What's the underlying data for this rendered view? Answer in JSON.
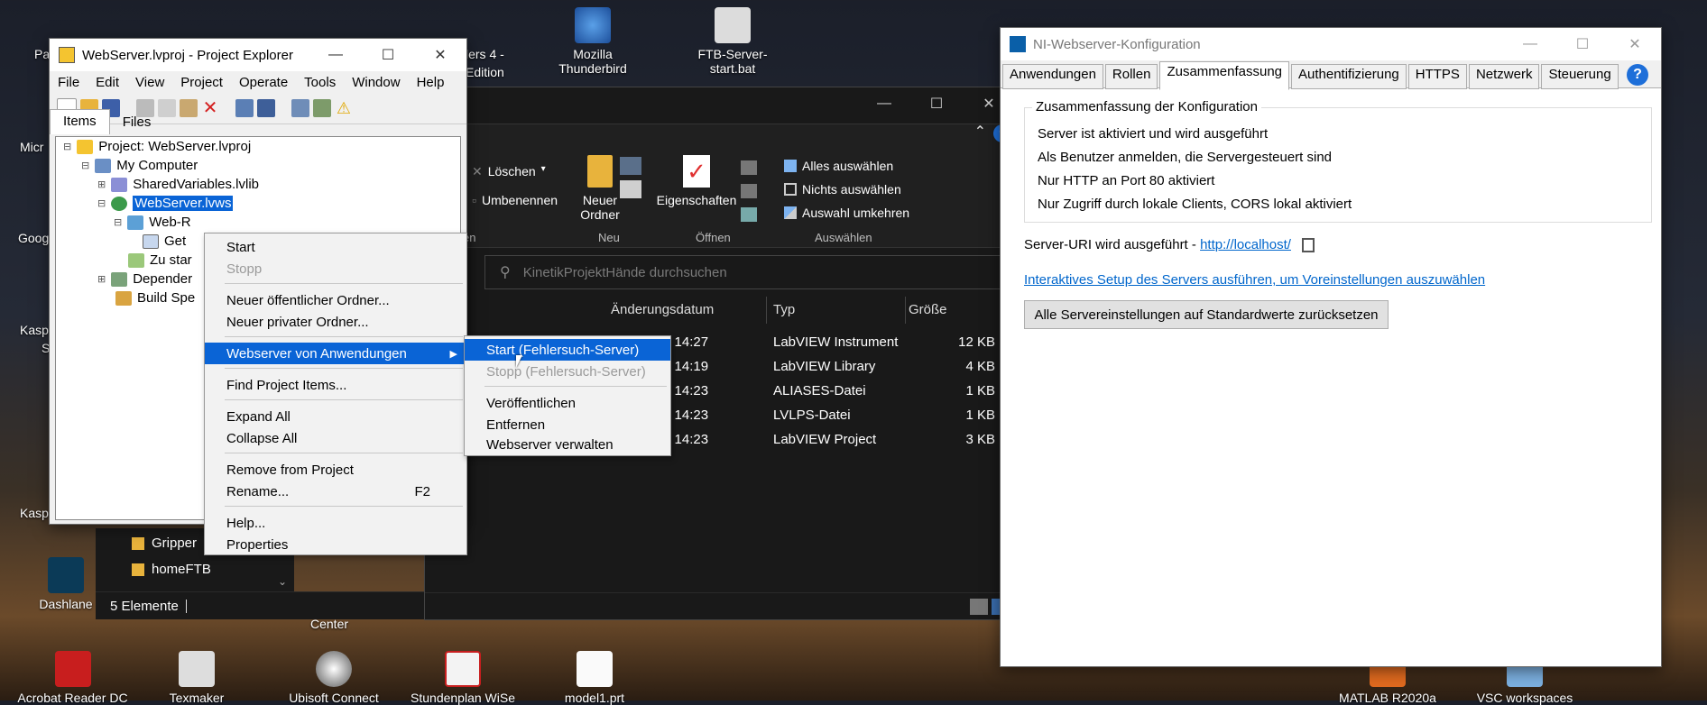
{
  "desktop": {
    "icons": [
      {
        "label": "Mozilla Thunderbird"
      },
      {
        "label": "FTB-Server-start.bat"
      },
      {
        "label": "Acrobat Reader DC"
      },
      {
        "label": "Texmaker"
      },
      {
        "label": "Ubisoft Connect"
      },
      {
        "label": "Stundenplan WiSe"
      },
      {
        "label": "model1.prt"
      },
      {
        "label": "MATLAB R2020a"
      },
      {
        "label": "VSC workspaces"
      },
      {
        "label": "Dashlane"
      }
    ],
    "partial_labels": [
      "Pa",
      "Micr",
      "Goog",
      "Kasp",
      "S",
      "Kasp",
      "lers 4 -",
      "Edition",
      "Center"
    ]
  },
  "project_explorer": {
    "title": "WebServer.lvproj - Project Explorer",
    "menu": [
      "File",
      "Edit",
      "View",
      "Project",
      "Operate",
      "Tools",
      "Window",
      "Help"
    ],
    "tabs": [
      "Items",
      "Files"
    ],
    "tree": [
      "Project: WebServer.lvproj",
      "My Computer",
      "SharedVariables.lvlib",
      "WebServer.lvws",
      "Web-R",
      "Get",
      "Zu star",
      "Depender",
      "Build Spe"
    ]
  },
  "context_menu": {
    "items": [
      {
        "label": "Start",
        "enabled": true
      },
      {
        "label": "Stopp",
        "enabled": false
      },
      {
        "label": "Neuer öffentlicher Ordner...",
        "enabled": true
      },
      {
        "label": "Neuer privater Ordner...",
        "enabled": true
      },
      {
        "label": "Webserver von Anwendungen",
        "enabled": true,
        "submenu": true
      },
      {
        "label": "Find Project Items...",
        "enabled": true
      },
      {
        "label": "Expand All",
        "enabled": true
      },
      {
        "label": "Collapse All",
        "enabled": true
      },
      {
        "label": "Remove from Project",
        "enabled": true
      },
      {
        "label": "Rename...",
        "enabled": true,
        "shortcut": "F2"
      },
      {
        "label": "Help...",
        "enabled": true
      },
      {
        "label": "Properties",
        "enabled": true
      }
    ]
  },
  "submenu": {
    "items": [
      {
        "label": "Start (Fehlersuch-Server)",
        "enabled": true
      },
      {
        "label": "Stopp (Fehlersuch-Server)",
        "enabled": false
      },
      {
        "label": "Veröffentlichen",
        "enabled": true
      },
      {
        "label": "Entfernen",
        "enabled": true
      },
      {
        "label": "Webserver verwalten",
        "enabled": true
      }
    ]
  },
  "file_explorer": {
    "ribbon": {
      "delete": "Löschen",
      "rename": "Umbenennen",
      "new_folder": "Neuer Ordner",
      "new_group": "Neu",
      "properties": "Eigenschaften",
      "open_group": "Öffnen",
      "select_all": "Alles auswählen",
      "select_none": "Nichts auswählen",
      "invert_selection": "Auswahl umkehren",
      "select_group": "Auswählen",
      "cut_group": "en"
    },
    "search_placeholder": "KinetikProjektHände durchsuchen",
    "columns": [
      "Änderungsdatum",
      "Typ",
      "Größe"
    ],
    "rows": [
      {
        "date": "2 14:27",
        "type": "LabVIEW Instrument",
        "size": "12 KB"
      },
      {
        "date": "2 14:19",
        "type": "LabVIEW Library",
        "size": "4 KB"
      },
      {
        "date": "2 14:23",
        "type": "ALIASES-Datei",
        "size": "1 KB"
      },
      {
        "date": "2 14:23",
        "type": "LVLPS-Datei",
        "size": "1 KB"
      },
      {
        "date": "2 14:23",
        "type": "LabVIEW Project",
        "size": "3 KB"
      }
    ],
    "nav_items": [
      "Gripper",
      "homeFTB"
    ],
    "status": "5 Elemente"
  },
  "ni_config": {
    "title": "NI-Webserver-Konfiguration",
    "tabs": [
      "Anwendungen",
      "Rollen",
      "Zusammenfassung",
      "Authentifizierung",
      "HTTPS",
      "Netzwerk",
      "Steuerung"
    ],
    "active_tab": "Zusammenfassung",
    "group_title": "Zusammenfassung der Konfiguration",
    "summary": [
      "Server ist aktiviert und wird ausgeführt",
      "Als Benutzer anmelden, die Servergesteuert sind",
      "Nur HTTP an Port 80 aktiviert",
      "Nur Zugriff durch lokale Clients, CORS lokal aktiviert"
    ],
    "uri_label": "Server-URI wird ausgeführt - ",
    "uri": "http://localhost/",
    "setup_link": "Interaktives Setup des Servers ausführen, um Voreinstellungen auszuwählen",
    "reset_button": "Alle Servereinstellungen auf Standardwerte zurücksetzen"
  }
}
